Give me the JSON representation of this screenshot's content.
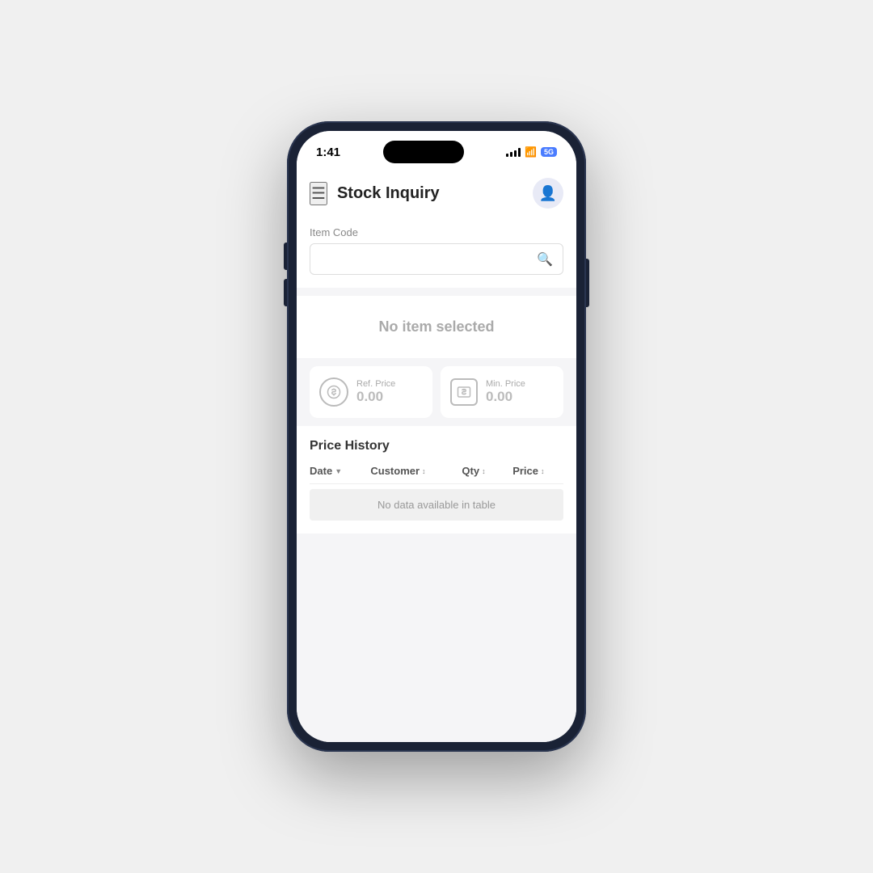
{
  "status": {
    "time": "1:41",
    "battery_label": "5G"
  },
  "header": {
    "title": "Stock Inquiry",
    "hamburger_label": "☰",
    "avatar_icon": "👤"
  },
  "search": {
    "label": "Item Code",
    "placeholder": "",
    "button_icon": "🔍"
  },
  "no_item": {
    "text": "No item selected"
  },
  "ref_price": {
    "label": "Ref. Price",
    "value": "0.00"
  },
  "min_price": {
    "label": "Min. Price",
    "value": "0.00"
  },
  "price_history": {
    "title": "Price History",
    "columns": {
      "date": "Date",
      "customer": "Customer",
      "qty": "Qty",
      "price": "Price"
    },
    "empty_text": "No data available in table"
  }
}
